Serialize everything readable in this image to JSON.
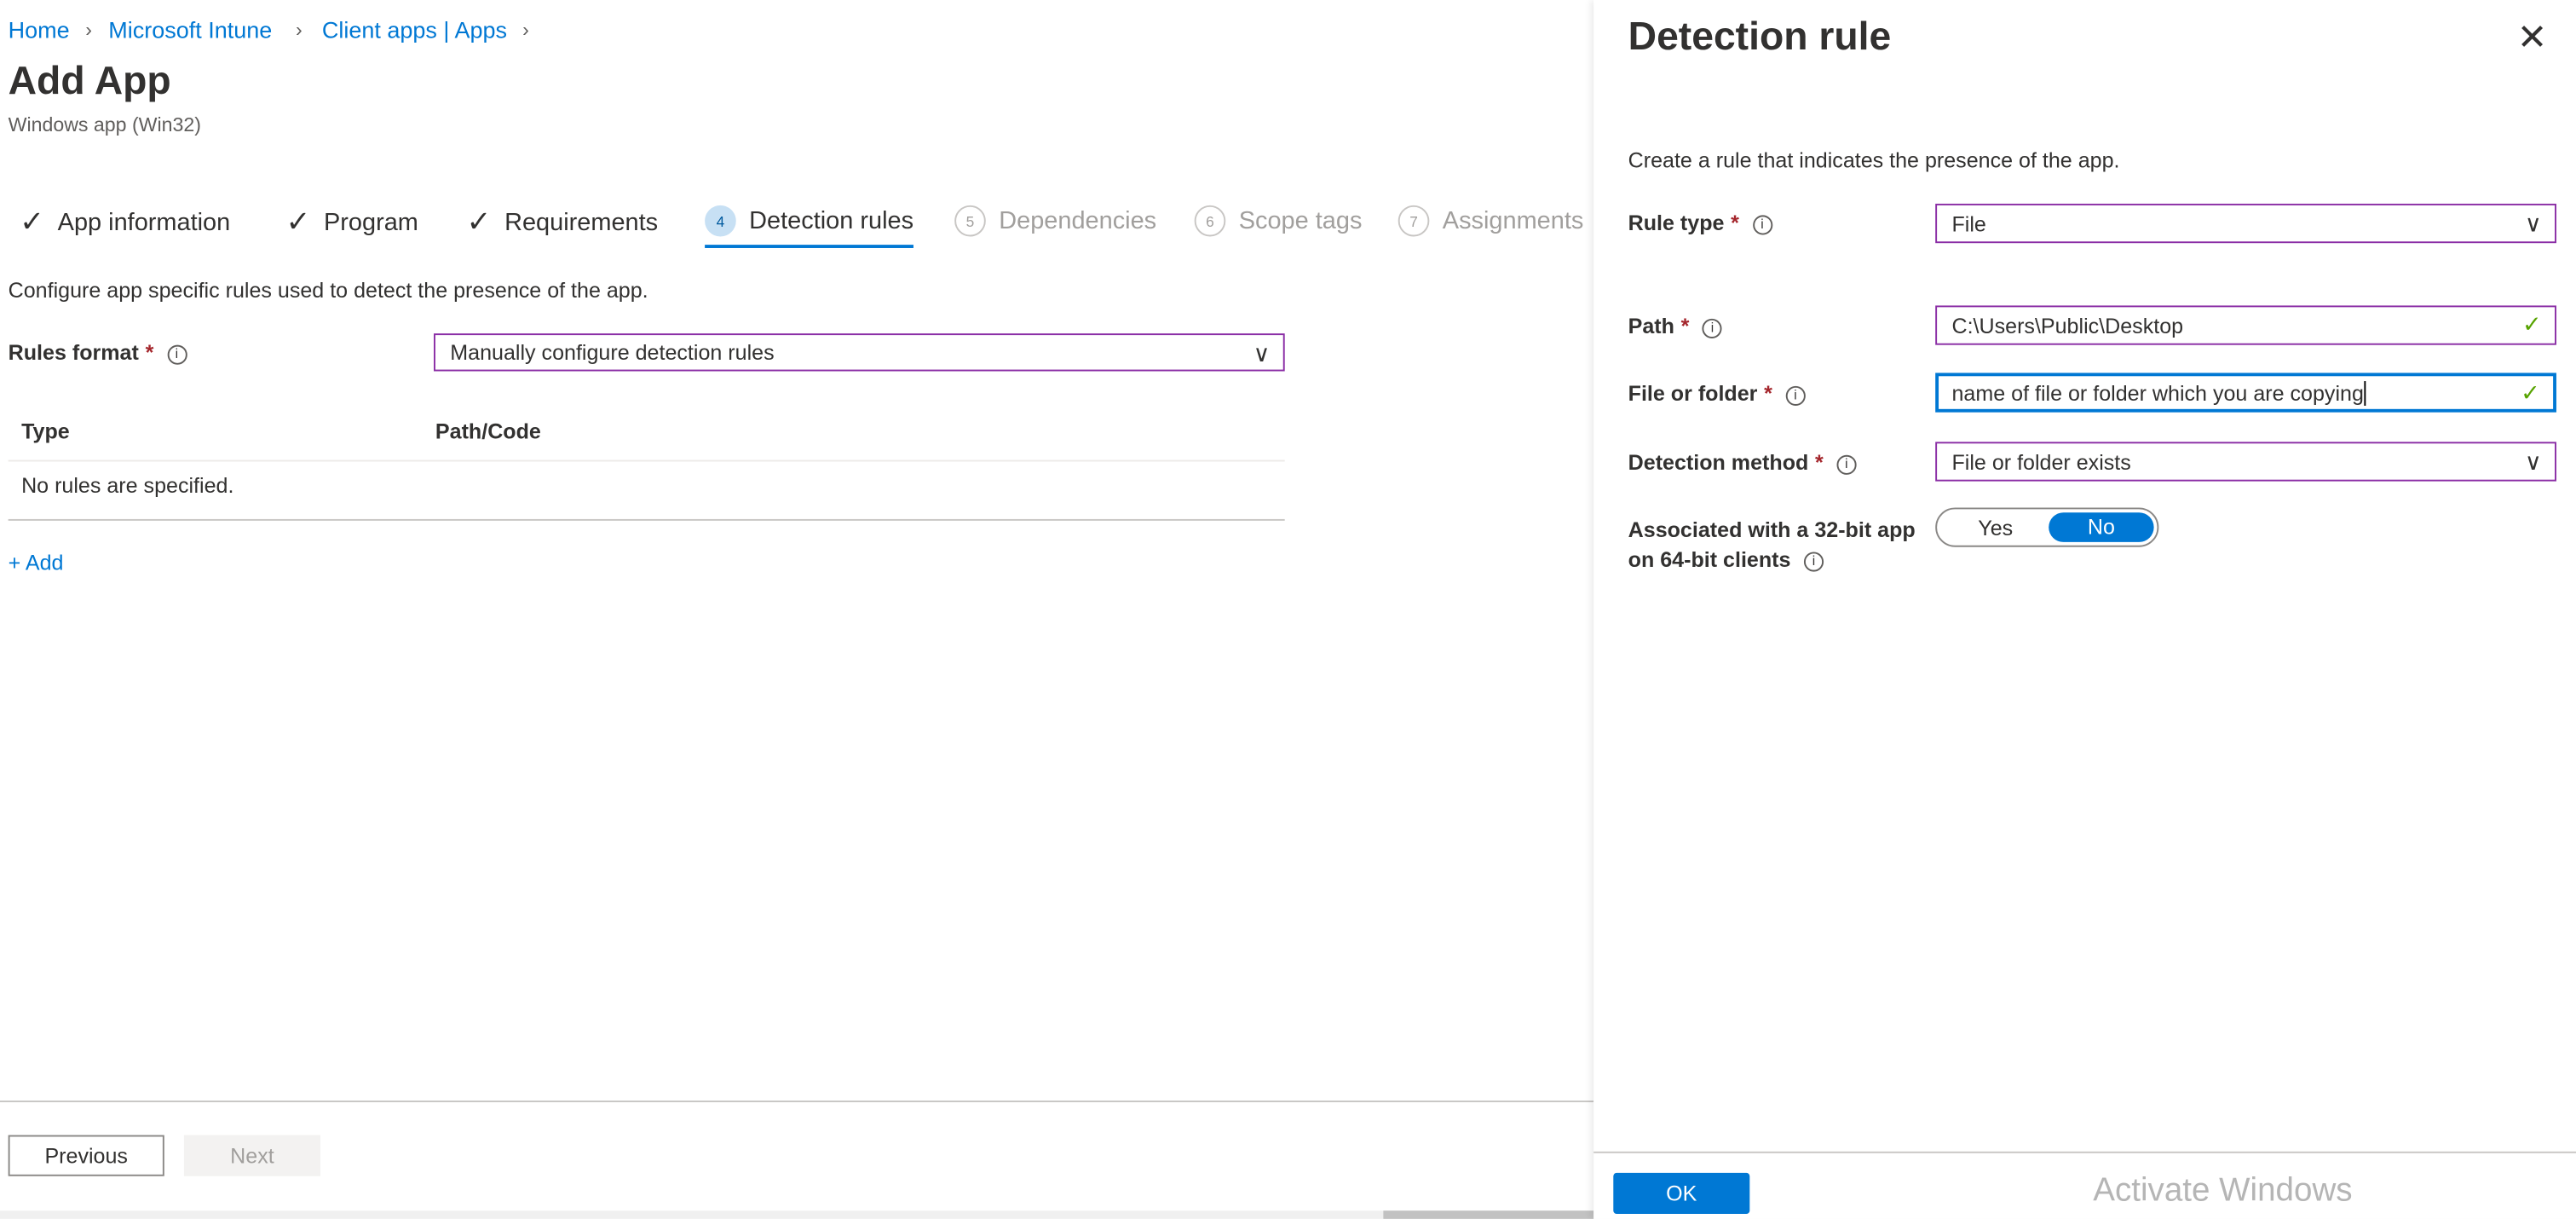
{
  "breadcrumb": [
    "Home",
    "Microsoft Intune",
    "Client apps | Apps"
  ],
  "page": {
    "title": "Add App",
    "subtitle": "Windows app (Win32)"
  },
  "tabs": [
    {
      "label": "App information",
      "state": "done"
    },
    {
      "label": "Program",
      "state": "done"
    },
    {
      "label": "Requirements",
      "state": "done"
    },
    {
      "number": "4",
      "label": "Detection rules",
      "state": "active"
    },
    {
      "number": "5",
      "label": "Dependencies",
      "state": "disabled"
    },
    {
      "number": "6",
      "label": "Scope tags",
      "state": "disabled"
    },
    {
      "number": "7",
      "label": "Assignments",
      "state": "disabled"
    }
  ],
  "main": {
    "description": "Configure app specific rules used to detect the presence of the app.",
    "rules_format_label": "Rules format",
    "rules_format_value": "Manually configure detection rules",
    "table": {
      "columns": [
        "Type",
        "Path/Code"
      ],
      "empty": "No rules are specified."
    },
    "add_label": "+ Add"
  },
  "footer": {
    "previous": "Previous",
    "next": "Next"
  },
  "panel": {
    "title": "Detection rule",
    "intro": "Create a rule that indicates the presence of the app.",
    "rule_type_label": "Rule type",
    "rule_type_value": "File",
    "path_label": "Path",
    "path_value": "C:\\Users\\Public\\Desktop",
    "file_label": "File or folder",
    "file_value": "name of file or folder which you are copying",
    "method_label": "Detection method",
    "method_value": "File or folder exists",
    "assoc_label_1": "Associated with a 32-bit app",
    "assoc_label_2": "on 64-bit clients",
    "toggle": {
      "yes": "Yes",
      "no": "No",
      "selected": "No"
    },
    "ok": "OK"
  },
  "watermark": "Activate Windows",
  "colors": {
    "accent": "#0078d4",
    "focus_border": "#8a2da5",
    "required": "#a4262c",
    "valid": "#57a300"
  }
}
